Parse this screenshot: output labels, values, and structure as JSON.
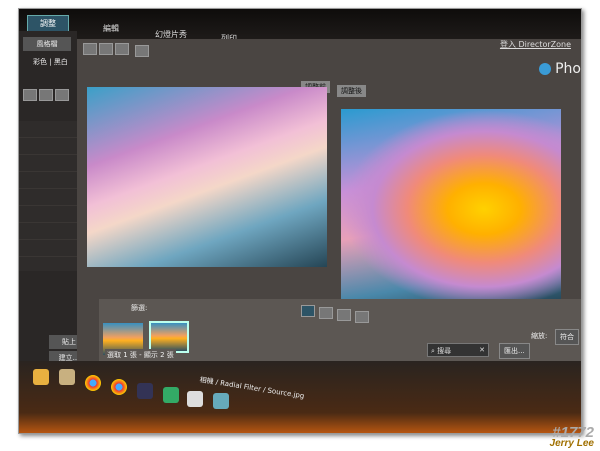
{
  "tabs": [
    {
      "label": "調整"
    },
    {
      "label": "編輯"
    },
    {
      "label": "幻燈片秀"
    },
    {
      "label": "列印"
    }
  ],
  "login_link": "登入 DirectorZone",
  "brand": "Pho",
  "sidebar": {
    "style_label": "風格檔",
    "color_label": "彩色",
    "bw_label": "黑白",
    "paste_label": "貼上",
    "create_label": "建立..."
  },
  "compare": {
    "before": "調整前",
    "after": "調整後"
  },
  "filter_label": "篩選:",
  "status": "選取 1 張 - 顯示 2 張",
  "search": {
    "placeholder": "搜尋"
  },
  "zoom": {
    "label": "縮放:",
    "value": "符合"
  },
  "export_label": "匯出...",
  "path": "相機 / Radial Filter / Source.jpg",
  "watermark": {
    "number": "#1772",
    "author": "Jerry Lee"
  }
}
